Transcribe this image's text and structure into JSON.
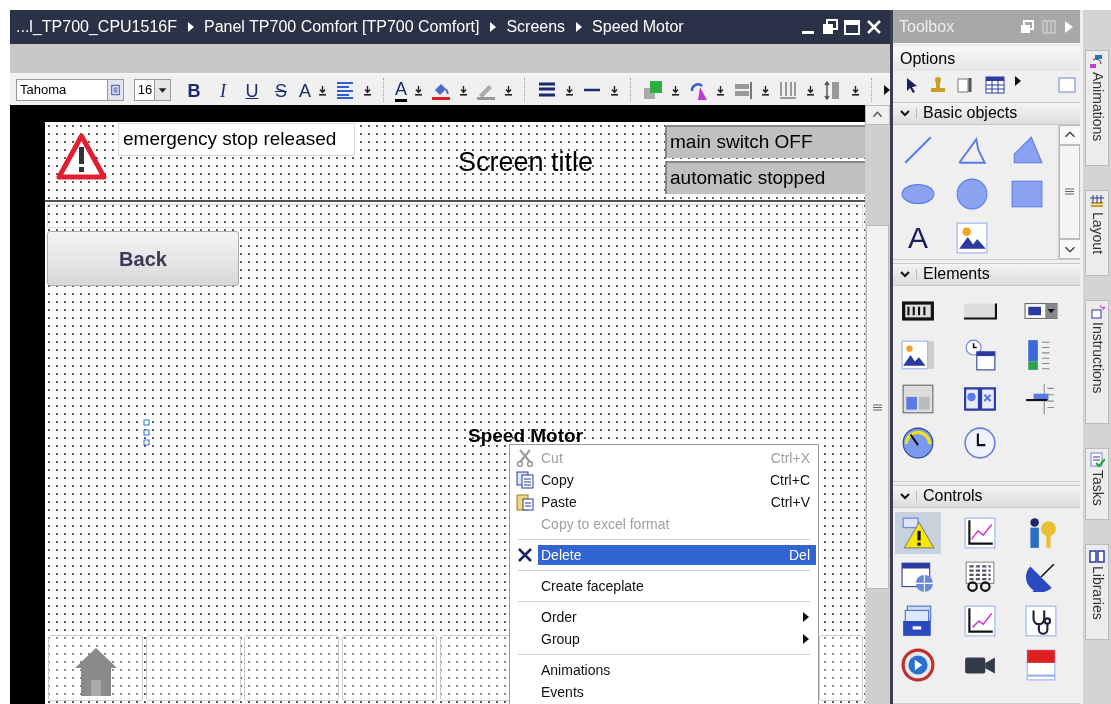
{
  "editor": {
    "breadcrumb": [
      "...l_TP700_CPU1516F",
      "Panel TP700 Comfort [TP700 Comfort]",
      "Screens",
      "Speed Motor"
    ]
  },
  "toolbar": {
    "font": "Tahoma",
    "font_size": "16",
    "glyphs": [
      "B",
      "I",
      "U",
      "S",
      "A",
      "A"
    ]
  },
  "screen": {
    "alarm": "emergency stop released",
    "title": "Screen title",
    "status": [
      "main switch OFF",
      "automatic stopped"
    ],
    "back_button": "Back",
    "text_field": "Speed Motor"
  },
  "context_menu": [
    {
      "kind": "item",
      "label": "Cut",
      "shortcut": "Ctrl+X",
      "disabled": true,
      "selected": false,
      "submenu": false
    },
    {
      "kind": "item",
      "label": "Copy",
      "shortcut": "Ctrl+C",
      "disabled": false,
      "selected": false,
      "submenu": false
    },
    {
      "kind": "item",
      "label": "Paste",
      "shortcut": "Ctrl+V",
      "disabled": false,
      "selected": false,
      "submenu": false
    },
    {
      "kind": "item",
      "label": "Copy to excel format",
      "disabled": true,
      "selected": false,
      "submenu": false
    },
    {
      "kind": "separator"
    },
    {
      "kind": "item",
      "label": "Delete",
      "shortcut": "Del",
      "disabled": false,
      "selected": true,
      "submenu": false
    },
    {
      "kind": "separator"
    },
    {
      "kind": "item",
      "label": "Create faceplate",
      "disabled": false,
      "selected": false,
      "submenu": false
    },
    {
      "kind": "separator"
    },
    {
      "kind": "item",
      "label": "Order",
      "disabled": false,
      "selected": false,
      "submenu": true
    },
    {
      "kind": "item",
      "label": "Group",
      "disabled": false,
      "selected": false,
      "submenu": true
    },
    {
      "kind": "separator"
    },
    {
      "kind": "item",
      "label": "Animations",
      "disabled": false,
      "selected": false,
      "submenu": false
    },
    {
      "kind": "item",
      "label": "Events",
      "disabled": false,
      "selected": false,
      "submenu": false
    }
  ],
  "toolbox": {
    "title": "Toolbox",
    "options": "Options",
    "sections": [
      {
        "title": "Basic objects",
        "expanded": true,
        "tools": [
          {
            "selected": false
          },
          {
            "selected": false
          },
          {
            "selected": false
          },
          {
            "selected": false
          },
          {
            "selected": false
          },
          {
            "selected": false
          },
          {
            "selected": false,
            "glyph": "A"
          },
          {
            "selected": false
          }
        ]
      },
      {
        "title": "Elements",
        "expanded": true,
        "tools": [
          {
            "selected": false
          },
          {
            "selected": false
          },
          {
            "selected": false
          },
          {
            "selected": false
          },
          {
            "selected": false
          },
          {
            "selected": false
          },
          {
            "selected": false
          },
          {
            "selected": false
          },
          {
            "selected": false
          },
          {
            "selected": false
          },
          {
            "selected": false
          }
        ]
      },
      {
        "title": "Controls",
        "expanded": true,
        "tools": [
          {
            "selected": true
          },
          {
            "selected": false
          },
          {
            "selected": false
          },
          {
            "selected": false
          },
          {
            "selected": false
          },
          {
            "selected": false
          },
          {
            "selected": false
          },
          {
            "selected": false
          },
          {
            "selected": false
          },
          {
            "selected": false
          },
          {
            "selected": false
          },
          {
            "selected": false
          }
        ]
      }
    ]
  },
  "side_tabs": [
    "Animations",
    "Layout",
    "Instructions",
    "Tasks",
    "Libraries"
  ]
}
